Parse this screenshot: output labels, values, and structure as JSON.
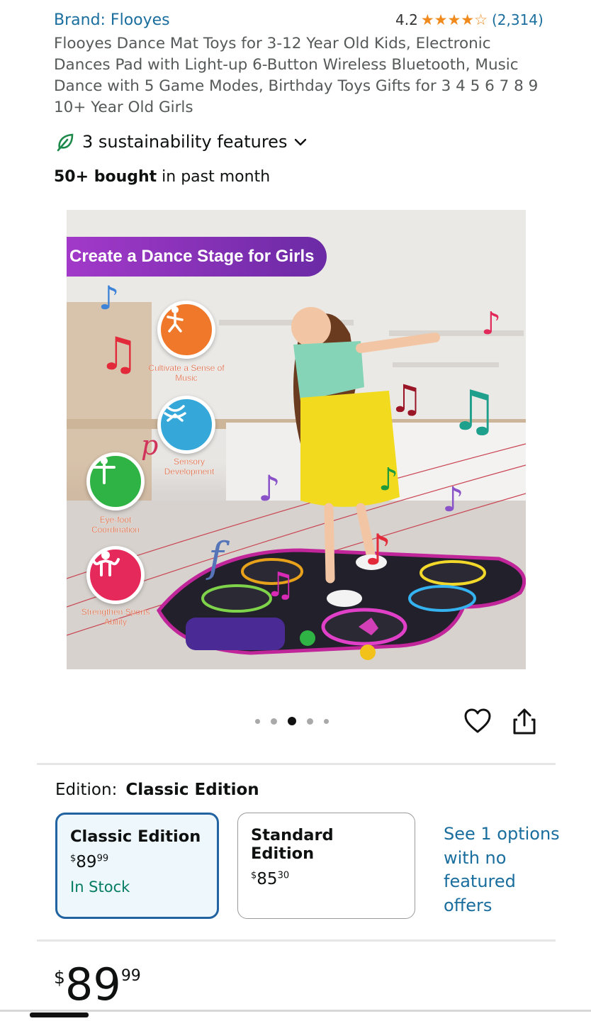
{
  "product": {
    "brand": "Brand: Flooyes",
    "rating": "4.2",
    "rating_value": 4.2,
    "rating_count": "(2,314)",
    "title": "Flooyes Dance Mat Toys for 3-12 Year Old Kids, Electronic Dances Pad with Light-up 6-Button Wireless Bluetooth, Music Dance with 5 Game Modes, Birthday Toys Gifts for 3 4 5 6 7 8 9 10+ Year Old Girls",
    "sustainability": "3 sustainability features",
    "bought_bold": "50+ bought",
    "bought_rest": " in past month"
  },
  "hero": {
    "banner": "Create a Dance Stage for Girls",
    "badges": [
      {
        "label": "Cultivate a Sense of Music",
        "color": "#f0782a"
      },
      {
        "label": "Sensory Development",
        "color": "#35a7d9"
      },
      {
        "label": "Eye-foot Coordination",
        "color": "#2fb344"
      },
      {
        "label": "Strengthen Sports Ability",
        "color": "#e6295b"
      }
    ]
  },
  "carousel": {
    "total": 5,
    "active_index": 2
  },
  "edition": {
    "label": "Edition:",
    "selected": "Classic Edition",
    "options": [
      {
        "name": "Classic Edition",
        "price_currency": "$",
        "price_whole": "89",
        "price_fraction": "99",
        "stock": "In Stock"
      },
      {
        "name": "Standard Edition",
        "price_currency": "$",
        "price_whole": "85",
        "price_fraction": "30"
      }
    ],
    "see_more": "See 1 options with no featured offers"
  },
  "price": {
    "currency": "$",
    "whole": "89",
    "fraction": "99"
  },
  "colors": {
    "link": "#1a6e9e",
    "star": "#f08a1c",
    "stock": "#067d62",
    "selected_border": "#2162a1"
  }
}
